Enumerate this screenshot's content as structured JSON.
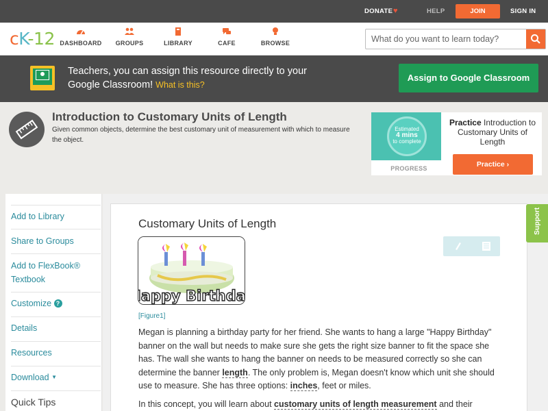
{
  "topbar": {
    "donate": "DONATE",
    "help": "HELP",
    "join": "JOIN",
    "signin": "SIGN IN"
  },
  "logo": {
    "part1": "c",
    "part2": "K",
    "part3": "-12"
  },
  "nav": {
    "items": [
      {
        "label": "DASHBOARD",
        "icon": "speedometer-icon"
      },
      {
        "label": "GROUPS",
        "icon": "people-icon"
      },
      {
        "label": "LIBRARY",
        "icon": "book-icon"
      },
      {
        "label": "CAFE",
        "icon": "chat-icon"
      },
      {
        "label": "BROWSE",
        "icon": "lightbulb-icon"
      }
    ]
  },
  "search": {
    "placeholder": "What do you want to learn today?"
  },
  "banner": {
    "text": "Teachers, you can assign this resource directly to your Google Classroom!",
    "what": "What is this?",
    "assign": "Assign to Google Classroom"
  },
  "concept": {
    "title": "Introduction to Customary Units of Length",
    "description": "Given common objects, determine the best customary unit of measurement with which to measure the object."
  },
  "practice_card": {
    "progress_line1": "Estimated",
    "progress_line2": "4 mins",
    "progress_line3": "to complete",
    "progress_label": "PROGRESS",
    "practice_bold": "Practice",
    "practice_rest": " Introduction to Customary Units of Length",
    "button": "Practice"
  },
  "sidebar": {
    "add_library": "Add to Library",
    "share_groups": "Share to Groups",
    "add_flexbook": "Add to FlexBook® Textbook",
    "customize": "Customize",
    "details": "Details",
    "resources": "Resources",
    "download": "Download",
    "quick_tips": "Quick Tips"
  },
  "main": {
    "title": "Customary Units of Length",
    "cake_text": "Happy Birthday",
    "figure": "[Figure1]",
    "p1_a": "Megan is planning a birthday party for her friend. She wants to hang a large \"Happy Birthday\" banner on the wall but needs to make sure she gets the right size banner to fit the space she has. The wall she wants to hang the banner on needs to be measured correctly so she can determine the banner ",
    "p1_term1": "length",
    "p1_b": ". The only problem is, Megan doesn't know which unit she should use to measure. She has three options: ",
    "p1_term2": "inches",
    "p1_c": ", feet or miles.",
    "p2_a": "In this concept, you will learn about ",
    "p2_term": "customary units of length measurement",
    "p2_b": " and their"
  },
  "support": "Support",
  "colors": {
    "accent_orange": "#f26a33",
    "accent_green": "#1f9b55",
    "link_teal": "#2a8b9c",
    "support_green": "#8cc34a",
    "dark_bar": "#4a4a4a"
  }
}
